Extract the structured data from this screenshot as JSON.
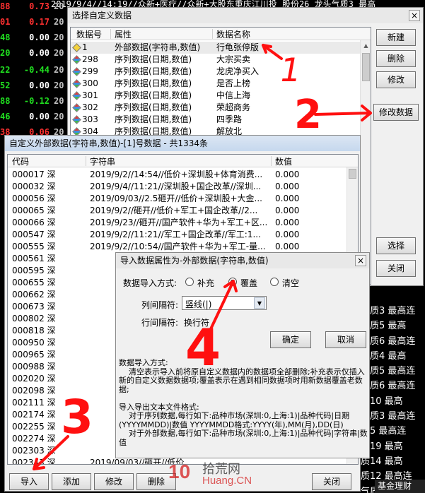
{
  "background": {
    "top_text": "2019/9/4//14:19//众新+医疗//众新+大股东重庆江川投 股份26 龙头气质3 最高",
    "rows": [
      {
        "code": "88",
        "val": "0.73",
        "yr": "20"
      },
      {
        "code": "01",
        "val": "0.17",
        "yr": "20"
      },
      {
        "code": "48",
        "val": "0.00",
        "yr": "20"
      },
      {
        "code": "20",
        "val": "0.00",
        "yr": "20"
      },
      {
        "code": "22",
        "val": "-0.44",
        "yr": "20"
      },
      {
        "code": "52",
        "val": "0.00",
        "yr": "20"
      },
      {
        "code": "88",
        "val": "-0.12",
        "yr": "20"
      },
      {
        "code": "46",
        "val": "0.00",
        "yr": "20"
      },
      {
        "code": "38",
        "val": "0.06",
        "yr": "20"
      }
    ],
    "right_rows": [
      "气质3 最高连",
      "气质5 最高",
      "气质6 最高连",
      "气质4 最高",
      "气质5 最高连",
      "气质6 最高连",
      "质10 最高",
      "气质3 最高连",
      "质5 最高连",
      "质19 最高",
      "质14 最高",
      "质12 最高连",
      "气质0 最高连"
    ],
    "bottom_right": "基金理财",
    "colors": {
      "red": "#ff3030",
      "green": "#20e020",
      "white": "#ffffff"
    }
  },
  "dialog_select": {
    "title": "选择自定义数据",
    "close": "×",
    "columns": [
      "数据号",
      "属性",
      "数据名称"
    ],
    "rows": [
      {
        "icon": "yellow-diamond",
        "num": "1",
        "attr": "外部数据(字符串,数值)",
        "name": "行龟张停版",
        "selected": true
      },
      {
        "icon": "multicolor-diamond",
        "num": "298",
        "attr": "序列数据(日期,数值)",
        "name": "大宗买卖"
      },
      {
        "icon": "multicolor-diamond",
        "num": "299",
        "attr": "序列数据(日期,数值)",
        "name": "龙虎净买入"
      },
      {
        "icon": "multicolor-diamond",
        "num": "300",
        "attr": "序列数据(日期,数值)",
        "name": "是否上榜"
      },
      {
        "icon": "multicolor-diamond",
        "num": "301",
        "attr": "序列数据(日期,数值)",
        "name": "中信上海"
      },
      {
        "icon": "multicolor-diamond",
        "num": "302",
        "attr": "序列数据(日期,数值)",
        "name": "荣超商务"
      },
      {
        "icon": "multicolor-diamond",
        "num": "303",
        "attr": "序列数据(日期,数值)",
        "name": "四季路"
      },
      {
        "icon": "multicolor-diamond",
        "num": "304",
        "attr": "序列数据(日期,数值)",
        "name": "解放北"
      }
    ],
    "buttons": {
      "new": "新建",
      "delete": "删除",
      "modify": "修改",
      "modify_data": "修改数据",
      "select": "选择",
      "close": "关闭"
    }
  },
  "dialog_ext": {
    "title": "自定义外部数据(字符串,数值)-[1]号数据 - 共1334条",
    "columns": [
      "代码",
      "字符串",
      "数值"
    ],
    "rows": [
      {
        "code": "000017 深",
        "str": "2019/9/2//14:54//低价+深圳股+体育消费...",
        "val": "0.000"
      },
      {
        "code": "000032 深",
        "str": "2019/9/4//11:21//深圳股+国企改革//深圳...",
        "val": "0.000"
      },
      {
        "code": "000056 深",
        "str": "2019/09/03//2.5砸开//低价+深圳股+大金...",
        "val": "0.000"
      },
      {
        "code": "000065 深",
        "str": "2019/9/2//砸开//低价+军工+国企改革//2...",
        "val": "0.000"
      },
      {
        "code": "000066 深",
        "str": "2019/9/23//砸开//国产软件+华为+军工+区...",
        "val": "0.000"
      },
      {
        "code": "000547 深",
        "str": "2019/9/2//11:21//军工+国企改革//军工:1...",
        "val": "0.000"
      },
      {
        "code": "000555 深",
        "str": "2019/9/2//10:54//国产软件+华为+军工-量...",
        "val": "0.000"
      },
      {
        "code": "000561 深",
        "str": "",
        "val": ""
      },
      {
        "code": "000595 深",
        "str": "",
        "val": ""
      },
      {
        "code": "000655 深",
        "str": "",
        "val": ""
      },
      {
        "code": "000662 深",
        "str": "",
        "val": ""
      },
      {
        "code": "000673 深",
        "str": "",
        "val": ""
      },
      {
        "code": "000802 深",
        "str": "",
        "val": ""
      },
      {
        "code": "000818 深",
        "str": "",
        "val": ""
      },
      {
        "code": "000950 深",
        "str": "",
        "val": ""
      },
      {
        "code": "000965 深",
        "str": "",
        "val": ""
      },
      {
        "code": "000988 深",
        "str": "",
        "val": ""
      },
      {
        "code": "002020 深",
        "str": "",
        "val": ""
      },
      {
        "code": "002098 深",
        "str": "",
        "val": ""
      },
      {
        "code": "002111 深",
        "str": "",
        "val": ""
      },
      {
        "code": "002174 深",
        "str": "",
        "val": ""
      },
      {
        "code": "002255 深",
        "str": "",
        "val": ""
      },
      {
        "code": "002274 深",
        "str": "",
        "val": ""
      },
      {
        "code": "002303 深",
        "str": "",
        "val": ""
      },
      {
        "code": "002343 深",
        "str": "2019/09/03//砸开//低价",
        "val": ""
      }
    ],
    "buttons": {
      "import": "导入",
      "add": "添加",
      "modify": "修改",
      "delete": "删除",
      "close": "关闭"
    }
  },
  "dialog_import": {
    "title": "导入数据属性为-外部数据(字符串,数值)",
    "close": "×",
    "import_mode_label": "数据导入方式:",
    "modes": [
      {
        "label": "补充",
        "checked": false
      },
      {
        "label": "覆盖",
        "checked": true
      },
      {
        "label": "清空",
        "checked": false
      }
    ],
    "col_sep_label": "列间隔符:",
    "col_sep_value": "竖线(|)",
    "row_sep_label": "行间隔符:",
    "row_sep_value": "换行符",
    "ok": "确定",
    "cancel": "取消",
    "help_text": "数据导入方式:\n    清空表示导入前将原自定义数据内的数据项全部删除;补充表示仅插入新的自定义数据数据项;覆盖表示在遇到相同数据项时用新数据覆盖老数据;\n\n导入导出文本文件格式:\n    对于序列数据,每行如下:品种市场(深圳:0,上海:1)|品种代码|日期(YYYYMMDD)|数值 YYYYMMDD格式:YYYY(年),MM(月),DD(日)\n    对于外部数据,每行如下:品种市场(深圳:0,上海:1)|品种代码|字符串|数值"
  },
  "annotations": {
    "n1": "1",
    "n2": "2",
    "n3": "3",
    "n4": "4"
  },
  "watermark": {
    "logo": "10",
    "cn": "拾荒网",
    "en": "Huang.CN"
  }
}
